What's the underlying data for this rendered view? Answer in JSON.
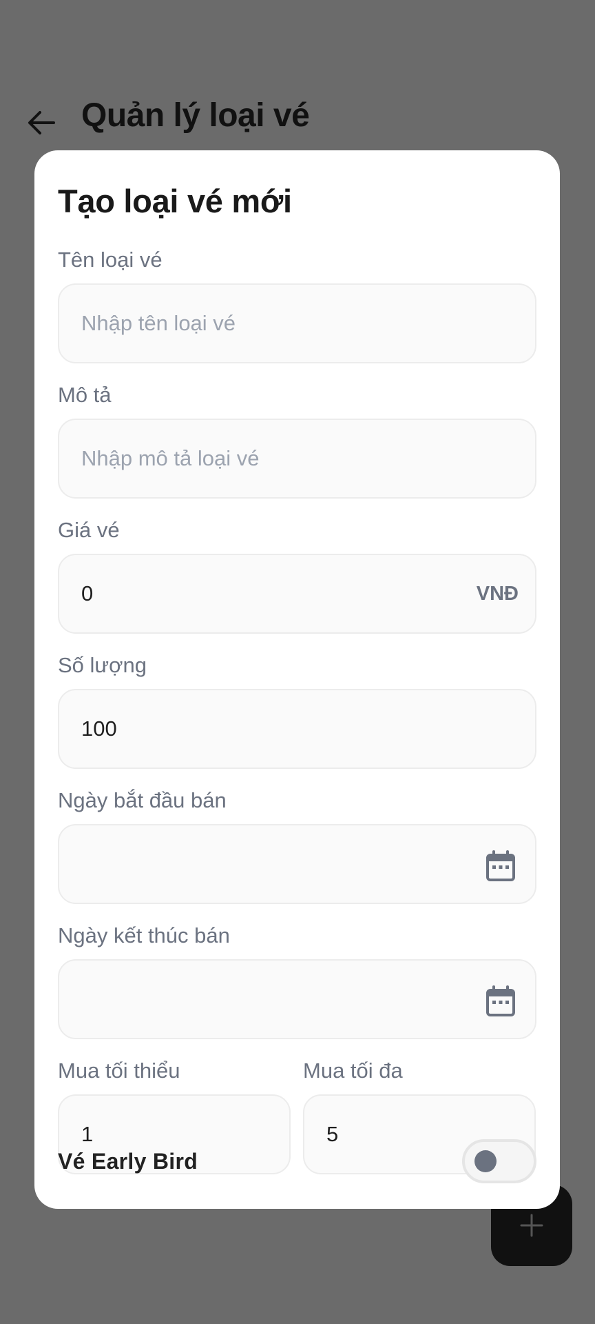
{
  "header": {
    "title": "Quản lý loại vé",
    "back_icon": "arrow-left-icon"
  },
  "fab": {
    "icon": "plus-icon"
  },
  "modal": {
    "title": "Tạo loại vé mới",
    "fields": {
      "name": {
        "label": "Tên loại vé",
        "placeholder": "Nhập tên loại vé",
        "value": ""
      },
      "description": {
        "label": "Mô tả",
        "placeholder": "Nhập mô tả loại vé",
        "value": ""
      },
      "price": {
        "label": "Giá vé",
        "value": "0",
        "suffix": "VNĐ"
      },
      "quantity": {
        "label": "Số lượng",
        "value": "100"
      },
      "start_date": {
        "label": "Ngày bắt đầu bán",
        "value": "",
        "icon": "calendar-icon"
      },
      "end_date": {
        "label": "Ngày kết thúc bán",
        "value": "",
        "icon": "calendar-icon"
      },
      "min_purchase": {
        "label": "Mua tối thiểu",
        "value": "1"
      },
      "max_purchase": {
        "label": "Mua tối đa",
        "value": "5"
      }
    },
    "early_bird": {
      "label": "Vé Early Bird",
      "enabled": false
    }
  },
  "colors": {
    "overlay": "#6b6b6b",
    "modal_bg": "#ffffff",
    "input_bg": "#fafafa",
    "label": "#6b7280",
    "fab_bg": "#111111"
  }
}
